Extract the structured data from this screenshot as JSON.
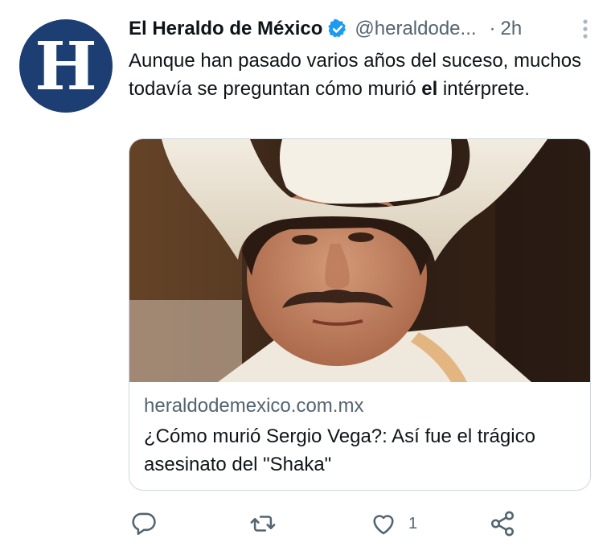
{
  "tweet": {
    "avatar_letter": "H",
    "display_name": "El Heraldo de México",
    "handle": "@heraldode...",
    "separator": "·",
    "time": "2h",
    "text_main": "Aunque han pasado varios años del suceso, muchos todavía se preguntan cómo murió ",
    "text_bold": "el",
    "text_end": " intérprete."
  },
  "card": {
    "domain": "heraldodemexico.com.mx",
    "title": "¿Cómo murió Sergio Vega?: Así fue el trágico asesinato del \"Shaka\""
  },
  "actions": {
    "reply_count": "",
    "retweet_count": "",
    "like_count": "1",
    "share_count": ""
  },
  "colors": {
    "brand_blue": "#1d3e73",
    "verified_blue": "#1d9bf0",
    "muted_text": "#536471",
    "text": "#0f1419",
    "border": "#cfd9de"
  },
  "icons": [
    "verified-badge-icon",
    "more-icon",
    "reply-icon",
    "retweet-icon",
    "like-icon",
    "share-icon"
  ]
}
